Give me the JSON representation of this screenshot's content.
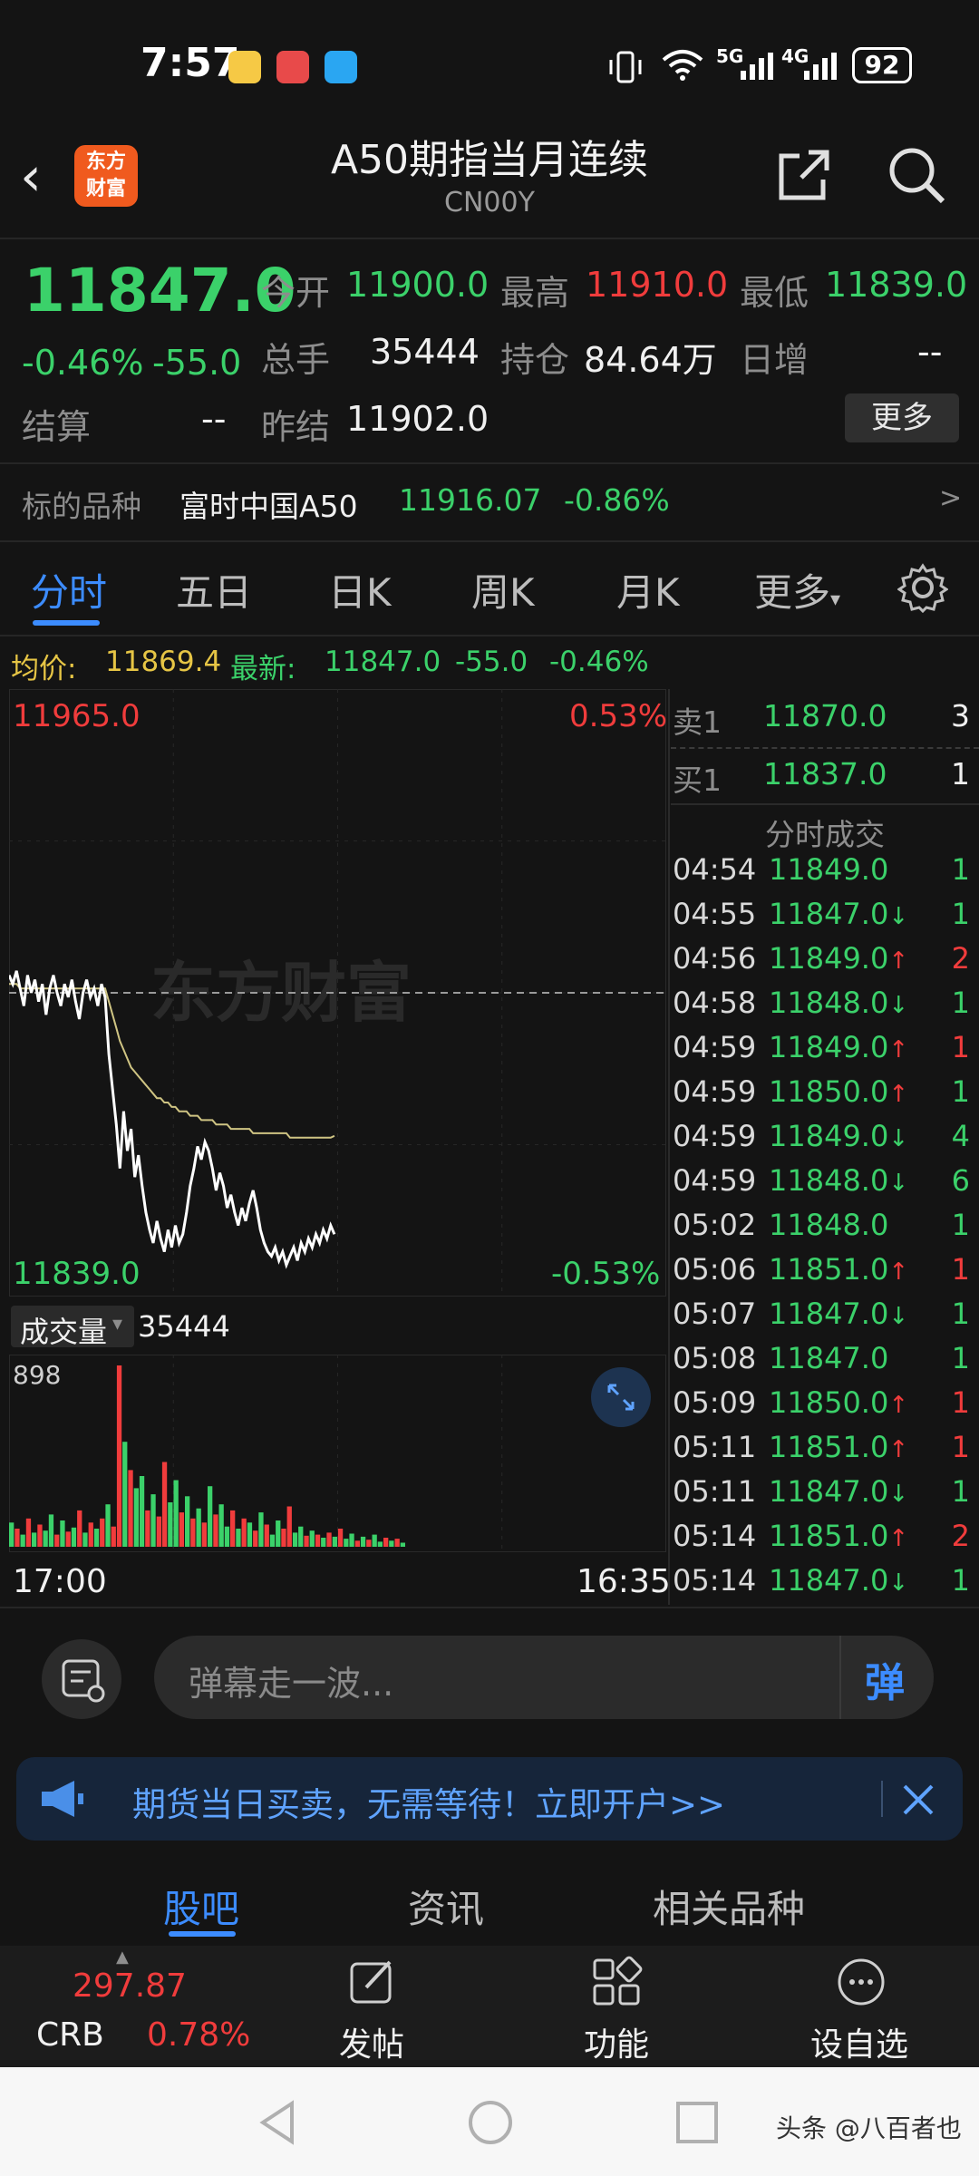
{
  "status": {
    "time": "7:57",
    "battery": "92",
    "network1": "5G",
    "network2": "4G"
  },
  "header": {
    "title": "A50期指当月连续",
    "code": "CN00Y",
    "logo_text_1": "东方",
    "logo_text_2": "财富"
  },
  "quote": {
    "price": "11847.0",
    "change_pct": "-0.46%",
    "change": "-55.0",
    "open_label": "今开",
    "open": "11900.0",
    "high_label": "最高",
    "high": "11910.0",
    "low_label": "最低",
    "low": "11839.0",
    "volume_label": "总手",
    "volume": "35444",
    "oi_label": "持仓",
    "oi": "84.64万",
    "daily_inc_label": "日增",
    "daily_inc": "--",
    "settle_label": "结算",
    "settle": "--",
    "prev_settle_label": "昨结",
    "prev_settle": "11902.0",
    "more_label": "更多"
  },
  "underlying": {
    "label": "标的品种",
    "name": "富时中国A50",
    "price": "11916.07",
    "change_pct": "-0.86%",
    "arrow": ">"
  },
  "tabs": [
    "分时",
    "五日",
    "日K",
    "周K",
    "月K",
    "更多"
  ],
  "chart_info": {
    "avg_label": "均价:",
    "avg": "11869.4",
    "latest_label": "最新:",
    "latest": "11847.0",
    "chg": "-55.0",
    "chg_pct": "-0.46%"
  },
  "chart_data": {
    "type": "line",
    "y_max_label": "11965.0",
    "y_min_label": "11839.0",
    "pct_max_label": "0.53%",
    "pct_min_label": "-0.53%",
    "ylim": [
      11839.0,
      11965.0
    ],
    "baseline": 11902.0,
    "watermark": "东方财富",
    "x_start": "17:00",
    "x_end": "16:35",
    "series": [
      {
        "name": "最新",
        "values": [
          11906,
          11904,
          11907,
          11903,
          11899,
          11906,
          11902,
          11905,
          11900,
          11904,
          11897,
          11903,
          11906,
          11902,
          11899,
          11904,
          11901,
          11905,
          11900,
          11896,
          11902,
          11905,
          11901,
          11903,
          11899,
          11904,
          11901,
          11888,
          11880,
          11872,
          11862,
          11875,
          11866,
          11871,
          11860,
          11865,
          11858,
          11852,
          11848,
          11845,
          11850,
          11846,
          11843,
          11848,
          11844,
          11849,
          11845,
          11847,
          11852,
          11858,
          11862,
          11867,
          11864,
          11868,
          11866,
          11862,
          11857,
          11861,
          11858,
          11853,
          11856,
          11852,
          11849,
          11853,
          11850,
          11854,
          11857,
          11853,
          11848,
          11845,
          11843,
          11842,
          11844,
          11841,
          11843,
          11840,
          11842,
          11844,
          11841,
          11845,
          11843,
          11846,
          11844,
          11847,
          11845,
          11848,
          11846,
          11849,
          11847
        ]
      },
      {
        "name": "均价",
        "values": [
          11904,
          11904,
          11904,
          11903,
          11903,
          11903,
          11903,
          11903,
          11903,
          11903,
          11903,
          11903,
          11903,
          11903,
          11903,
          11903,
          11903,
          11903,
          11903,
          11903,
          11903,
          11903,
          11903,
          11903,
          11903,
          11903,
          11903,
          11900,
          11897,
          11894,
          11891,
          11889,
          11887,
          11885,
          11884,
          11883,
          11882,
          11881,
          11880,
          11879,
          11878,
          11878,
          11877,
          11877,
          11876,
          11876,
          11875,
          11875,
          11875,
          11874,
          11874,
          11874,
          11873,
          11873,
          11873,
          11873,
          11872,
          11872,
          11872,
          11872,
          11871,
          11871,
          11871,
          11871,
          11871,
          11871,
          11870,
          11870,
          11870,
          11870,
          11870,
          11870,
          11870,
          11870,
          11870,
          11870,
          11869,
          11869,
          11869,
          11869,
          11869,
          11869,
          11869,
          11869,
          11869,
          11869,
          11869,
          11869,
          11869.4
        ]
      }
    ],
    "total_slots": 240
  },
  "volume_chart": {
    "label": "成交量",
    "total": "35444",
    "max_label": "898",
    "max": 898,
    "bars": [
      {
        "v": 120,
        "c": "g"
      },
      {
        "v": 90,
        "c": "r"
      },
      {
        "v": 60,
        "c": "g"
      },
      {
        "v": 140,
        "c": "r"
      },
      {
        "v": 70,
        "c": "g"
      },
      {
        "v": 110,
        "c": "r"
      },
      {
        "v": 80,
        "c": "g"
      },
      {
        "v": 160,
        "c": "g"
      },
      {
        "v": 60,
        "c": "r"
      },
      {
        "v": 130,
        "c": "g"
      },
      {
        "v": 75,
        "c": "r"
      },
      {
        "v": 95,
        "c": "g"
      },
      {
        "v": 180,
        "c": "r"
      },
      {
        "v": 70,
        "c": "g"
      },
      {
        "v": 120,
        "c": "r"
      },
      {
        "v": 90,
        "c": "g"
      },
      {
        "v": 140,
        "c": "r"
      },
      {
        "v": 210,
        "c": "g"
      },
      {
        "v": 100,
        "c": "r"
      },
      {
        "v": 898,
        "c": "r"
      },
      {
        "v": 520,
        "c": "g"
      },
      {
        "v": 380,
        "c": "r"
      },
      {
        "v": 290,
        "c": "g"
      },
      {
        "v": 350,
        "c": "g"
      },
      {
        "v": 180,
        "c": "r"
      },
      {
        "v": 260,
        "c": "g"
      },
      {
        "v": 150,
        "c": "r"
      },
      {
        "v": 420,
        "c": "r"
      },
      {
        "v": 220,
        "c": "g"
      },
      {
        "v": 330,
        "c": "g"
      },
      {
        "v": 170,
        "c": "r"
      },
      {
        "v": 250,
        "c": "g"
      },
      {
        "v": 140,
        "c": "r"
      },
      {
        "v": 190,
        "c": "g"
      },
      {
        "v": 120,
        "c": "r"
      },
      {
        "v": 300,
        "c": "g"
      },
      {
        "v": 160,
        "c": "r"
      },
      {
        "v": 210,
        "c": "g"
      },
      {
        "v": 100,
        "c": "g"
      },
      {
        "v": 180,
        "c": "r"
      },
      {
        "v": 90,
        "c": "g"
      },
      {
        "v": 140,
        "c": "r"
      },
      {
        "v": 120,
        "c": "g"
      },
      {
        "v": 80,
        "c": "r"
      },
      {
        "v": 170,
        "c": "g"
      },
      {
        "v": 110,
        "c": "r"
      },
      {
        "v": 60,
        "c": "g"
      },
      {
        "v": 130,
        "c": "g"
      },
      {
        "v": 90,
        "c": "r"
      },
      {
        "v": 200,
        "c": "r"
      },
      {
        "v": 70,
        "c": "g"
      },
      {
        "v": 100,
        "c": "g"
      },
      {
        "v": 55,
        "c": "r"
      },
      {
        "v": 80,
        "c": "g"
      },
      {
        "v": 60,
        "c": "r"
      },
      {
        "v": 45,
        "c": "g"
      },
      {
        "v": 70,
        "c": "r"
      },
      {
        "v": 50,
        "c": "g"
      },
      {
        "v": 90,
        "c": "r"
      },
      {
        "v": 40,
        "c": "g"
      },
      {
        "v": 65,
        "c": "g"
      },
      {
        "v": 30,
        "c": "r"
      },
      {
        "v": 50,
        "c": "g"
      },
      {
        "v": 35,
        "c": "r"
      },
      {
        "v": 60,
        "c": "g"
      },
      {
        "v": 25,
        "c": "g"
      },
      {
        "v": 45,
        "c": "r"
      },
      {
        "v": 30,
        "c": "g"
      },
      {
        "v": 40,
        "c": "r"
      },
      {
        "v": 20,
        "c": "g"
      }
    ]
  },
  "orderbook": {
    "sell_label": "卖1",
    "sell_price": "11870.0",
    "sell_vol": "3",
    "buy_label": "买1",
    "buy_price": "11837.0",
    "buy_vol": "1",
    "ticks_title": "分时成交",
    "ticks": [
      {
        "t": "04:54",
        "p": "11849.0",
        "a": "",
        "v": "1",
        "c": "g"
      },
      {
        "t": "04:55",
        "p": "11847.0",
        "a": "↓",
        "v": "1",
        "c": "g"
      },
      {
        "t": "04:56",
        "p": "11849.0",
        "a": "↑",
        "v": "2",
        "c": "r"
      },
      {
        "t": "04:58",
        "p": "11848.0",
        "a": "↓",
        "v": "1",
        "c": "g"
      },
      {
        "t": "04:59",
        "p": "11849.0",
        "a": "↑",
        "v": "1",
        "c": "r"
      },
      {
        "t": "04:59",
        "p": "11850.0",
        "a": "↑",
        "v": "1",
        "c": "g"
      },
      {
        "t": "04:59",
        "p": "11849.0",
        "a": "↓",
        "v": "4",
        "c": "g"
      },
      {
        "t": "04:59",
        "p": "11848.0",
        "a": "↓",
        "v": "6",
        "c": "g"
      },
      {
        "t": "05:02",
        "p": "11848.0",
        "a": "",
        "v": "1",
        "c": "g"
      },
      {
        "t": "05:06",
        "p": "11851.0",
        "a": "↑",
        "v": "1",
        "c": "r"
      },
      {
        "t": "05:07",
        "p": "11847.0",
        "a": "↓",
        "v": "1",
        "c": "g"
      },
      {
        "t": "05:08",
        "p": "11847.0",
        "a": "",
        "v": "1",
        "c": "g"
      },
      {
        "t": "05:09",
        "p": "11850.0",
        "a": "↑",
        "v": "1",
        "c": "r"
      },
      {
        "t": "05:11",
        "p": "11851.0",
        "a": "↑",
        "v": "1",
        "c": "r"
      },
      {
        "t": "05:11",
        "p": "11847.0",
        "a": "↓",
        "v": "1",
        "c": "g"
      },
      {
        "t": "05:14",
        "p": "11851.0",
        "a": "↑",
        "v": "2",
        "c": "r"
      },
      {
        "t": "05:14",
        "p": "11847.0",
        "a": "↓",
        "v": "1",
        "c": "g"
      }
    ]
  },
  "danmu": {
    "placeholder": "弹幕走一波...",
    "send": "弹"
  },
  "banner": {
    "text": "期货当日买卖，无需等待！立即开户>>"
  },
  "bottom_tabs": [
    "股吧",
    "资讯",
    "相关品种"
  ],
  "navbar": {
    "ticker_price": "297.87",
    "ticker_name": "CRB",
    "ticker_pct": "0.78%",
    "items": [
      "发帖",
      "功能",
      "设自选"
    ]
  },
  "watermark_credit": "头条 @八百者也",
  "colors": {
    "up": "#f03c3c",
    "down": "#3bd16a",
    "accent": "#3c8cff",
    "bg": "#141414"
  }
}
